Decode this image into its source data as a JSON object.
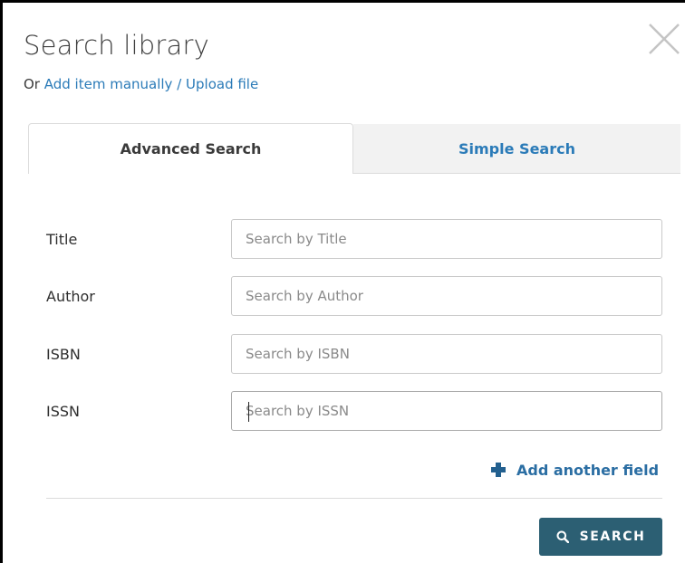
{
  "dialog": {
    "title": "Search library",
    "subtitle_prefix": "Or ",
    "subtitle_link": "Add item manually / Upload file"
  },
  "tabs": [
    {
      "label": "Advanced Search",
      "active": true
    },
    {
      "label": "Simple Search",
      "active": false
    }
  ],
  "fields": [
    {
      "label": "Title",
      "placeholder": "Search by Title",
      "value": ""
    },
    {
      "label": "Author",
      "placeholder": "Search by Author",
      "value": ""
    },
    {
      "label": "ISBN",
      "placeholder": "Search by ISBN",
      "value": ""
    },
    {
      "label": "ISSN",
      "placeholder": "Search by ISSN",
      "value": "",
      "focused": true
    }
  ],
  "actions": {
    "add_field_label": "Add another field",
    "add_field_icon": "plus-icon",
    "search_label": "SEARCH",
    "search_icon": "search-icon",
    "close_icon": "close-icon"
  },
  "colors": {
    "link": "#2b7bb8",
    "primary_button": "#2c5f73",
    "inactive_tab_bg": "#f2f2f2"
  }
}
